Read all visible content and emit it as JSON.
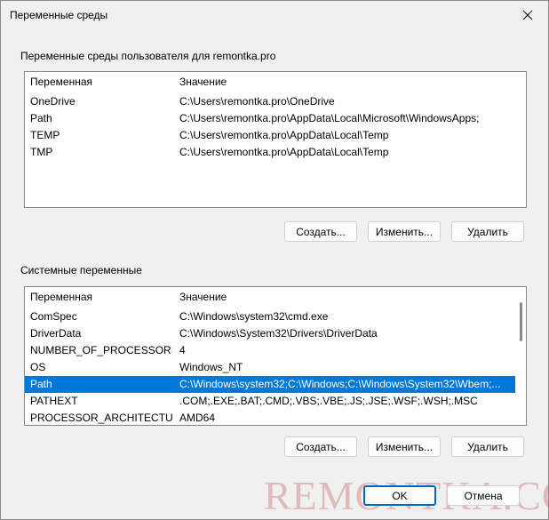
{
  "window": {
    "title": "Переменные среды"
  },
  "user_section": {
    "label": "Переменные среды пользователя для remontka.pro",
    "columns": [
      "Переменная",
      "Значение"
    ],
    "rows": [
      {
        "name": "OneDrive",
        "value": "C:\\Users\\remontka.pro\\OneDrive"
      },
      {
        "name": "Path",
        "value": "C:\\Users\\remontka.pro\\AppData\\Local\\Microsoft\\WindowsApps;"
      },
      {
        "name": "TEMP",
        "value": "C:\\Users\\remontka.pro\\AppData\\Local\\Temp"
      },
      {
        "name": "TMP",
        "value": "C:\\Users\\remontka.pro\\AppData\\Local\\Temp"
      }
    ],
    "buttons": {
      "create": "Создать...",
      "edit": "Изменить...",
      "delete": "Удалить"
    }
  },
  "system_section": {
    "label": "Системные переменные",
    "columns": [
      "Переменная",
      "Значение"
    ],
    "rows": [
      {
        "name": "ComSpec",
        "value": "C:\\Windows\\system32\\cmd.exe"
      },
      {
        "name": "DriverData",
        "value": "C:\\Windows\\System32\\Drivers\\DriverData"
      },
      {
        "name": "NUMBER_OF_PROCESSORS",
        "value": "4"
      },
      {
        "name": "OS",
        "value": "Windows_NT"
      },
      {
        "name": "Path",
        "value": "C:\\Windows\\system32;C:\\Windows;C:\\Windows\\System32\\Wbem;..."
      },
      {
        "name": "PATHEXT",
        "value": ".COM;.EXE;.BAT;.CMD;.VBS;.VBE;.JS;.JSE;.WSF;.WSH;.MSC"
      },
      {
        "name": "PROCESSOR_ARCHITECTURE",
        "value": "AMD64"
      }
    ],
    "selected_row": "Path",
    "buttons": {
      "create": "Создать...",
      "edit": "Изменить...",
      "delete": "Удалить"
    }
  },
  "dialog_buttons": {
    "ok": "OK",
    "cancel": "Отмена"
  },
  "watermark": "REMONTKA.COM",
  "colors": {
    "selection": "#0078d7",
    "accent_border": "#0067c0"
  },
  "icons": {
    "close": "close-icon"
  }
}
